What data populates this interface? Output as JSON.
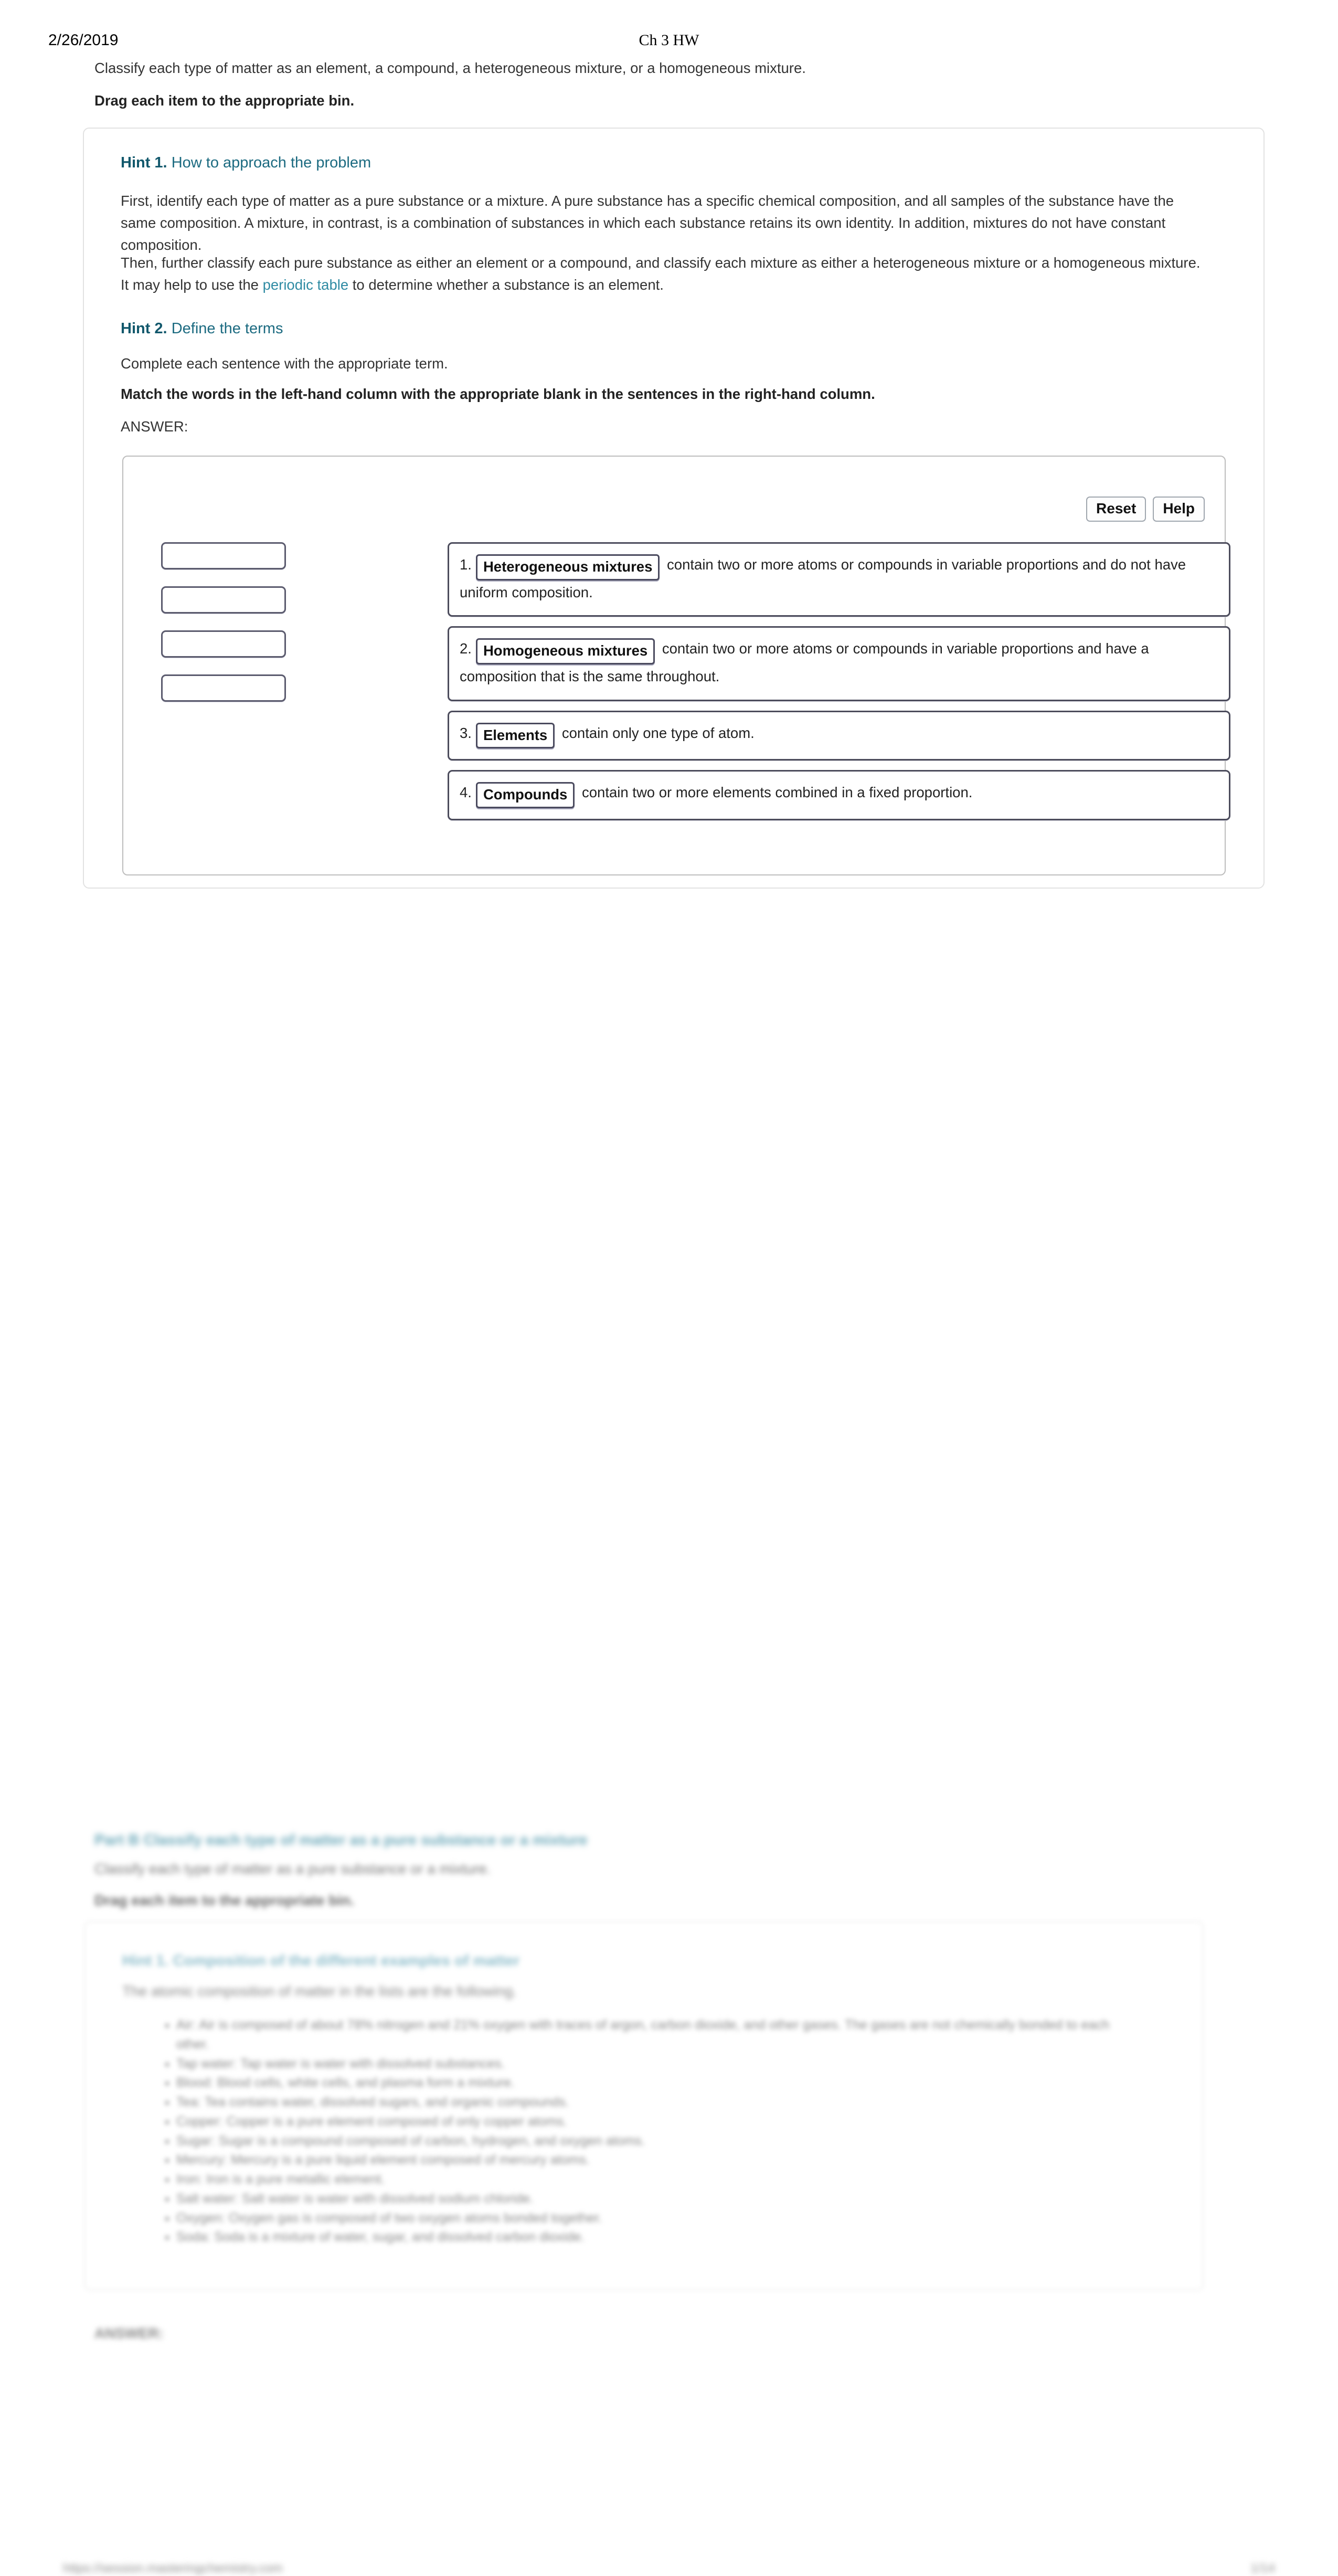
{
  "page_header": {
    "date": "2/26/2019",
    "doc_title": "Ch 3 HW"
  },
  "intro": {
    "prompt": "Classify each type of matter as an element, a compound, a heterogeneous mixture, or a homogeneous mixture.",
    "instruction": "Drag each item to the appropriate bin."
  },
  "hint1": {
    "label": "Hint 1.",
    "title": "How to approach the problem",
    "para1": "First, identify each type of matter as a pure substance or a mixture. A pure substance has a specific chemical composition, and all samples of the substance have the same composition. A mixture, in contrast, is a combination of substances in which each substance retains its own identity. In addition, mixtures do not have constant composition.",
    "para2_before": "Then, further classify each pure substance as either an element or a compound, and classify each mixture as either a heterogeneous mixture or a homogeneous mixture. It may help to use the ",
    "link_text": "periodic table",
    "para2_after": " to determine whether a substance is an element."
  },
  "hint2": {
    "label": "Hint 2.",
    "title": "Define the terms",
    "para1": "Complete each sentence with the appropriate term.",
    "instruction": "Match the words in the left-hand column with the appropriate blank in the sentences in the right-hand column.",
    "answer_label": "ANSWER:"
  },
  "answer_panel": {
    "reset_label": "Reset",
    "help_label": "Help",
    "source_bins": [
      {
        "value": ""
      },
      {
        "value": ""
      },
      {
        "value": ""
      },
      {
        "value": ""
      }
    ],
    "rows": [
      {
        "num": "1.",
        "chip": "Heterogeneous mixtures",
        "text": " contain two or more atoms or compounds in variable proportions and do not have uniform composition."
      },
      {
        "num": "2.",
        "chip": "Homogeneous mixtures",
        "text": " contain two or more atoms or compounds in variable proportions and have a composition that is the same throughout."
      },
      {
        "num": "3.",
        "chip": "Elements",
        "text": " contain only one type of atom."
      },
      {
        "num": "4.",
        "chip": "Compounds",
        "text": " contain two or more elements combined in a fixed proportion."
      }
    ]
  },
  "blurred_section": {
    "heading": "Part B Classify each type of matter as a pure substance or a mixture",
    "subtitle": "Classify each type of matter as a pure substance or a mixture.",
    "instruction": "Drag each item to the appropriate bin.",
    "card_heading": "Hint 1. Composition of the different examples of matter",
    "card_para": "The atomic composition of matter in the lists are the following.",
    "list_items": [
      "Air: Air is composed of about 78% nitrogen and 21% oxygen with traces of argon, carbon dioxide, and other gases. The gases are not chemically bonded to each other.",
      "Tap water: Tap water is water with dissolved substances.",
      "Blood: Blood cells, white cells, and plasma form a mixture.",
      "Tea: Tea contains water, dissolved sugars, and organic compounds.",
      "Copper: Copper is a pure element composed of only copper atoms.",
      "Sugar: Sugar is a compound composed of carbon, hydrogen, and oxygen atoms.",
      "Mercury: Mercury is a pure liquid element composed of mercury atoms.",
      "Iron: Iron is a pure metallic element.",
      "Salt water: Salt water is water with dissolved sodium chloride.",
      "Oxygen: Oxygen gas is composed of two oxygen atoms bonded together.",
      "Soda: Soda is a mixture of water, sugar, and dissolved carbon dioxide."
    ],
    "answer_label": "ANSWER:",
    "footer_left": "https://session.masteringchemistry.com",
    "footer_right": "1/14"
  }
}
